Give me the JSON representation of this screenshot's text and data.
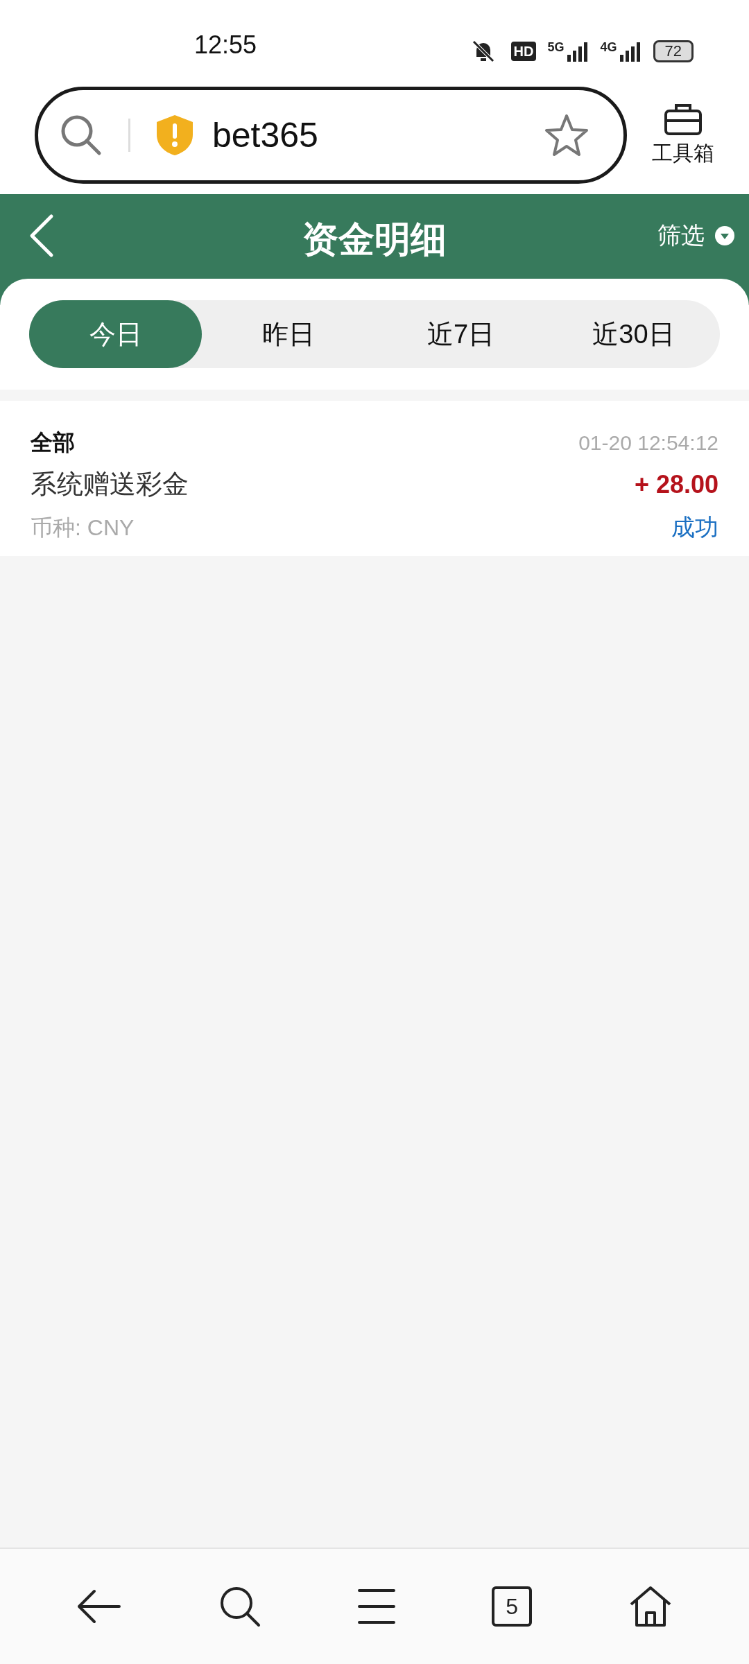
{
  "status_bar": {
    "time": "12:55",
    "hd": "HD",
    "networks": [
      "5G",
      "4G"
    ],
    "battery": "72"
  },
  "browser": {
    "url": "bet365",
    "toolbox_label": "工具箱"
  },
  "header": {
    "title": "资金明细",
    "filter_label": "筛选"
  },
  "tabs": [
    {
      "label": "今日",
      "selected": true
    },
    {
      "label": "昨日",
      "selected": false
    },
    {
      "label": "近7日",
      "selected": false
    },
    {
      "label": "近30日",
      "selected": false
    }
  ],
  "records": [
    {
      "category": "全部",
      "time": "01-20 12:54:12",
      "description": "系统赠送彩金",
      "amount": "+ 28.00",
      "currency": "币种: CNY",
      "status": "成功"
    }
  ],
  "bottom_nav": {
    "tab_count": "5"
  }
}
